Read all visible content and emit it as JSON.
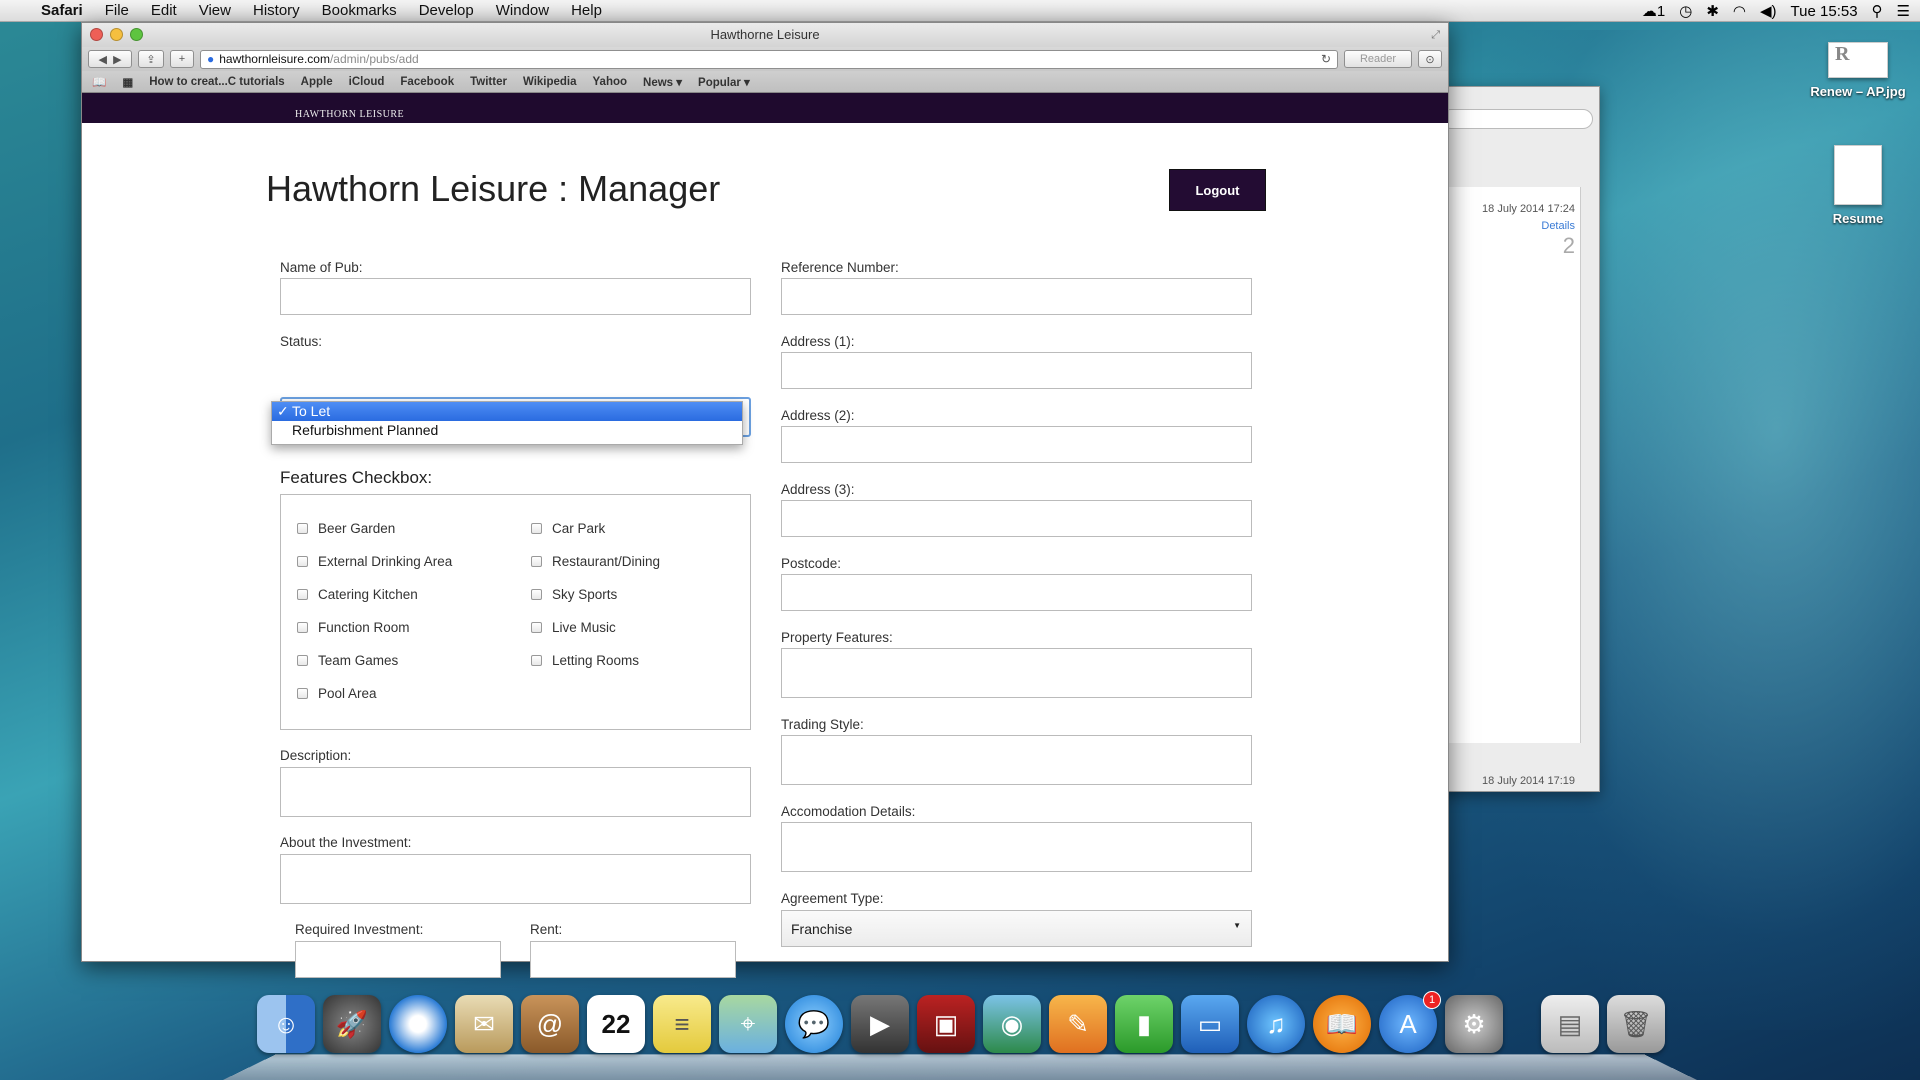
{
  "menubar": {
    "app": "Safari",
    "items": [
      "File",
      "Edit",
      "View",
      "History",
      "Bookmarks",
      "Develop",
      "Window",
      "Help"
    ],
    "status": {
      "cloud_count": "1",
      "clock": "Tue 15:53"
    }
  },
  "desktop": {
    "icons": [
      {
        "label": "Renew – AP.jpg",
        "thumb_text": "R"
      },
      {
        "label": "Resume"
      }
    ]
  },
  "background_window": {
    "date1": "18 July 2014 17:24",
    "link": "Details",
    "num": "2",
    "date2": "18 July 2014 17:19"
  },
  "browser": {
    "title": "Hawthorne Leisure",
    "url_domain": "hawthornleisure.com",
    "url_path": "/admin/pubs/add",
    "reader_label": "Reader",
    "bookmarks": [
      "How to creat...C tutorials",
      "Apple",
      "iCloud",
      "Facebook",
      "Twitter",
      "Wikipedia",
      "Yahoo",
      "News ▾",
      "Popular ▾"
    ]
  },
  "site": {
    "logo_text": "HAWTHORN LEISURE",
    "heading": "Hawthorn Leisure : Manager",
    "logout_label": "Logout"
  },
  "form": {
    "left": {
      "name_label": "Name of Pub:",
      "status_label": "Status:",
      "status_options": [
        "To Let",
        "Refurbishment Planned"
      ],
      "status_selected": "To Let",
      "features_heading": "Features Checkbox:",
      "features_col1": [
        "Beer Garden",
        "External Drinking Area",
        "Catering Kitchen",
        "Function Room",
        "Team Games",
        "Pool Area"
      ],
      "features_col2": [
        "Car Park",
        "Restaurant/Dining",
        "Sky Sports",
        "Live Music",
        "Letting Rooms"
      ],
      "description_label": "Description:",
      "investment_about_label": "About the Investment:",
      "required_investment_label": "Required Investment:",
      "rent_label": "Rent:"
    },
    "right": {
      "reference_label": "Reference Number:",
      "address1_label": "Address (1):",
      "address2_label": "Address (2):",
      "address3_label": "Address (3):",
      "postcode_label": "Postcode:",
      "property_features_label": "Property Features:",
      "trading_style_label": "Trading Style:",
      "accommodation_label": "Accomodation Details:",
      "agreement_label": "Agreement Type:",
      "agreement_value": "Franchise"
    }
  },
  "dock": {
    "apps": [
      "Finder",
      "Launchpad",
      "Safari",
      "Mail",
      "Contacts",
      "Calendar",
      "Notes",
      "Maps",
      "Messages",
      "FaceTime",
      "Photo Booth",
      "iPhoto",
      "Pages",
      "Numbers",
      "Keynote",
      "iTunes",
      "iBooks",
      "App Store",
      "System Preferences",
      "Documents",
      "Trash"
    ],
    "calendar_day": "22",
    "appstore_badge": "1"
  }
}
